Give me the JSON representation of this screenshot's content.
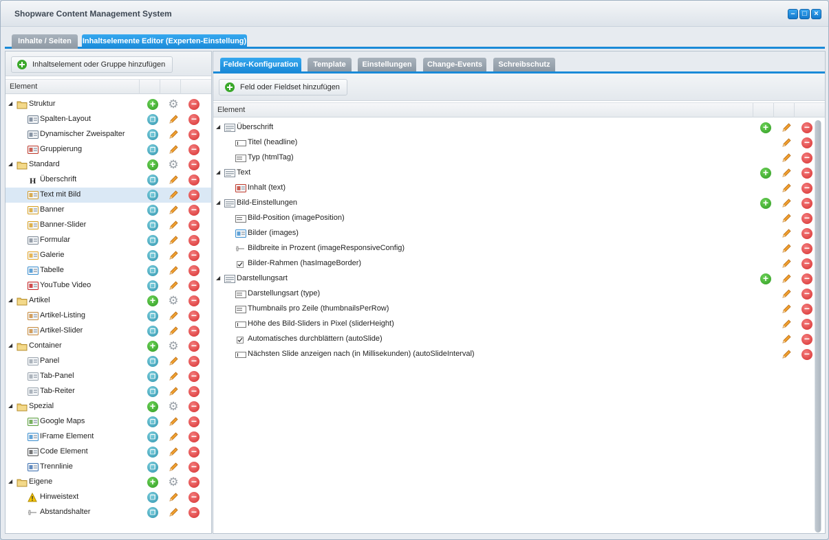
{
  "window": {
    "title": "Shopware Content Management System",
    "minimize": "–",
    "maximize": "□",
    "close": "×"
  },
  "main_tabs": [
    {
      "label": "Inhalte / Seiten",
      "active": false
    },
    {
      "label": "Inhaltselemente Editor (Experten-Einstellung)",
      "active": true
    }
  ],
  "left": {
    "add_button": "Inhaltselement oder Gruppe hinzufügen",
    "header": "Element",
    "rows": [
      {
        "label": "Struktur",
        "group": true,
        "icon": "folder-icon"
      },
      {
        "label": "Spalten-Layout",
        "group": false,
        "icon": "columns-layout-icon"
      },
      {
        "label": "Dynamischer Zweispalter",
        "group": false,
        "icon": "two-column-icon"
      },
      {
        "label": "Gruppierung",
        "group": false,
        "icon": "grouping-icon"
      },
      {
        "label": "Standard",
        "group": true,
        "icon": "folder-icon"
      },
      {
        "label": "Überschrift",
        "group": false,
        "icon": "heading-icon"
      },
      {
        "label": "Text mit Bild",
        "group": false,
        "icon": "text-image-icon",
        "selected": true
      },
      {
        "label": "Banner",
        "group": false,
        "icon": "banner-icon"
      },
      {
        "label": "Banner-Slider",
        "group": false,
        "icon": "banner-slider-icon"
      },
      {
        "label": "Formular",
        "group": false,
        "icon": "form-icon"
      },
      {
        "label": "Galerie",
        "group": false,
        "icon": "gallery-icon"
      },
      {
        "label": "Tabelle",
        "group": false,
        "icon": "table-icon"
      },
      {
        "label": "YouTube Video",
        "group": false,
        "icon": "video-icon"
      },
      {
        "label": "Artikel",
        "group": true,
        "icon": "folder-icon"
      },
      {
        "label": "Artikel-Listing",
        "group": false,
        "icon": "package-icon"
      },
      {
        "label": "Artikel-Slider",
        "group": false,
        "icon": "package-icon"
      },
      {
        "label": "Container",
        "group": true,
        "icon": "folder-icon"
      },
      {
        "label": "Panel",
        "group": false,
        "icon": "panel-icon"
      },
      {
        "label": "Tab-Panel",
        "group": false,
        "icon": "tab-panel-icon"
      },
      {
        "label": "Tab-Reiter",
        "group": false,
        "icon": "tab-icon"
      },
      {
        "label": "Spezial",
        "group": true,
        "icon": "folder-icon"
      },
      {
        "label": "Google Maps",
        "group": false,
        "icon": "map-icon"
      },
      {
        "label": "IFrame Element",
        "group": false,
        "icon": "iframe-icon"
      },
      {
        "label": "Code Element",
        "group": false,
        "icon": "code-icon"
      },
      {
        "label": "Trennlinie",
        "group": false,
        "icon": "divider-icon"
      },
      {
        "label": "Eigene",
        "group": true,
        "icon": "folder-icon"
      },
      {
        "label": "Hinweistext",
        "group": false,
        "icon": "warning-icon"
      },
      {
        "label": "Abstandshalter",
        "group": false,
        "icon": "spacer-icon"
      }
    ]
  },
  "right": {
    "tabs": [
      {
        "label": "Felder-Konfiguration",
        "active": true
      },
      {
        "label": "Template",
        "active": false
      },
      {
        "label": "Einstellungen",
        "active": false
      },
      {
        "label": "Change-Events",
        "active": false
      },
      {
        "label": "Schreibschutz",
        "active": false
      }
    ],
    "add_button": "Feld oder Fieldset hinzufügen",
    "header": "Element",
    "rows": [
      {
        "label": "Überschrift",
        "group": true,
        "icon": "fieldset-icon"
      },
      {
        "label": "Titel (headline)",
        "group": false,
        "icon": "textfield-icon"
      },
      {
        "label": "Typ (htmlTag)",
        "group": false,
        "icon": "combobox-icon"
      },
      {
        "label": "Text",
        "group": true,
        "icon": "fieldset-icon"
      },
      {
        "label": "Inhalt (text)",
        "group": false,
        "icon": "html-editor-icon"
      },
      {
        "label": "Bild-Einstellungen",
        "group": true,
        "icon": "fieldset-icon"
      },
      {
        "label": "Bild-Position (imagePosition)",
        "group": false,
        "icon": "combobox-icon"
      },
      {
        "label": "Bilder (images)",
        "group": false,
        "icon": "media-icon"
      },
      {
        "label": "Bildbreite in Prozent (imageResponsiveConfig)",
        "group": false,
        "icon": "slider-icon"
      },
      {
        "label": "Bilder-Rahmen (hasImageBorder)",
        "group": false,
        "icon": "checkbox-icon"
      },
      {
        "label": "Darstellungsart",
        "group": true,
        "icon": "fieldset-icon"
      },
      {
        "label": "Darstellungsart (type)",
        "group": false,
        "icon": "combobox-icon"
      },
      {
        "label": "Thumbnails pro Zeile (thumbnailsPerRow)",
        "group": false,
        "icon": "combobox-icon"
      },
      {
        "label": "Höhe des Bild-Sliders in Pixel (sliderHeight)",
        "group": false,
        "icon": "textfield-icon"
      },
      {
        "label": "Automatisches durchblättern (autoSlide)",
        "group": false,
        "icon": "checkbox-icon"
      },
      {
        "label": "Nächsten Slide anzeigen nach (in Millisekunden) (autoSlideInterval)",
        "group": false,
        "icon": "textfield-icon"
      }
    ]
  }
}
